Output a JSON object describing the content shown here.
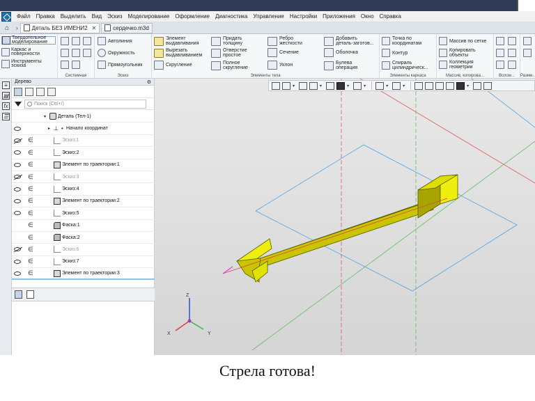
{
  "menu": {
    "items": [
      "Файл",
      "Правка",
      "Выделить",
      "Вид",
      "Эскиз",
      "Моделирование",
      "Оформление",
      "Диагностика",
      "Управление",
      "Настройки",
      "Приложения",
      "Окно",
      "Справка"
    ]
  },
  "tabs": [
    {
      "label": "Деталь БЕЗ ИМЕНИ2",
      "active": true,
      "closable": true
    },
    {
      "label": "сердечко.m3d",
      "active": false,
      "closable": false
    }
  ],
  "ribbon": {
    "modes": [
      "Твердотельное\nмоделирование",
      "Каркас и\nповерхности",
      "Инструменты\nэскиза"
    ],
    "groups": {
      "system": "Системная",
      "sketch": "Эскиз",
      "body": "Элементы тела",
      "frame": "Элементы каркаса",
      "array": "Массив, копирова...",
      "aux": "Вспом...",
      "size": "Разме..."
    },
    "sketch_buttons": [
      "Автолиния",
      "Окружность",
      "Прямоугольник"
    ],
    "body_buttons": [
      "Элемент\nвыдавливания",
      "Вырезать\nвыдавливанием",
      "Скругление",
      "Придать\nтолщину",
      "Отверстие\nпростое",
      "Полное\nскругление",
      "Ребро\nжесткости",
      "Сечение",
      "Уклон",
      "Добавить\nдеталь-заготов...",
      "Оболочка",
      "Булева\nоперация"
    ],
    "frame_buttons": [
      "Точка по\nкоординатам",
      "Контур",
      "Спираль\nцилиндрическ..."
    ],
    "array_buttons": [
      "Массив по сетке",
      "Копировать\nобъекты",
      "Коллекция\nгеометрии"
    ]
  },
  "tree": {
    "title": "Дерево",
    "search_placeholder": "Поиск (Ctrl+/)",
    "root": "Деталь (Тел-1)",
    "origin": "Начало координат",
    "rows": [
      {
        "label": "Эскиз:1",
        "dim": true,
        "eye": "off",
        "icon": "sketch"
      },
      {
        "label": "Эскиз:2",
        "dim": false,
        "eye": "on",
        "icon": "sketch"
      },
      {
        "label": "Элемент по траектории:1",
        "dim": false,
        "eye": "on",
        "icon": "elem"
      },
      {
        "label": "Эскиз:3",
        "dim": true,
        "eye": "off",
        "icon": "sketch"
      },
      {
        "label": "Эскиз:4",
        "dim": false,
        "eye": "on",
        "icon": "sketch"
      },
      {
        "label": "Элемент по траектории:2",
        "dim": false,
        "eye": "on",
        "icon": "elem"
      },
      {
        "label": "Эскиз:5",
        "dim": false,
        "eye": "on",
        "icon": "sketch"
      },
      {
        "label": "Фаска:1",
        "dim": false,
        "eye": "none",
        "icon": "fillet"
      },
      {
        "label": "Фаска:2",
        "dim": false,
        "eye": "none",
        "icon": "fillet"
      },
      {
        "label": "Эскиз:6",
        "dim": true,
        "eye": "off",
        "icon": "sketch"
      },
      {
        "label": "Эскиз:7",
        "dim": false,
        "eye": "on",
        "icon": "sketch"
      },
      {
        "label": "Элемент по траектории:3",
        "dim": false,
        "eye": "on",
        "icon": "elem"
      }
    ]
  },
  "viewport": {
    "axes": {
      "x": "X",
      "y": "Y",
      "z": "Z"
    },
    "colors": {
      "arrow": "#e1e000",
      "arrow_edge": "#5a5a00",
      "plane_blue": "#4fa3e0",
      "plane_red": "#e35a5a",
      "plane_green": "#5fbf5f"
    }
  },
  "caption": "Стрела готова!"
}
